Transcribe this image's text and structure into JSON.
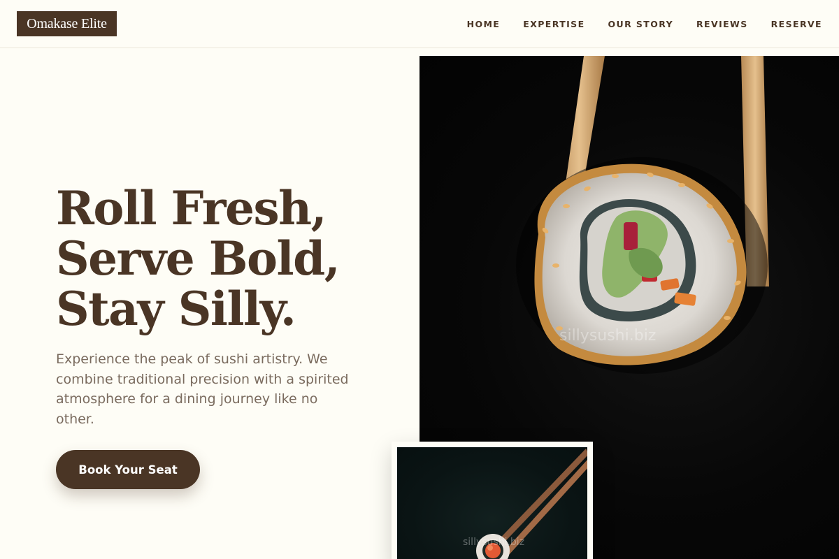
{
  "header": {
    "logo": "Omakase Elite",
    "nav": [
      "HOME",
      "EXPERTISE",
      "OUR STORY",
      "REVIEWS",
      "RESERVE"
    ]
  },
  "hero": {
    "title_lines": [
      "Roll Fresh,",
      "Serve Bold,",
      "Stay Silly."
    ],
    "subtitle": "Experience the peak of sushi artistry. We combine traditional precision with a spirited atmosphere for a dining journey like no other.",
    "cta_label": "Book Your Seat"
  },
  "images": {
    "main_photo": "sushi-roll-with-chopsticks",
    "inset_photo": "salmon-sushi-with-chopsticks",
    "main_watermark": "sillysushi.biz",
    "inset_watermark": "sillysushi.biz"
  },
  "colors": {
    "brand": "#4a3525",
    "background": "#fefdf6",
    "body_text": "#7a6b5e"
  }
}
